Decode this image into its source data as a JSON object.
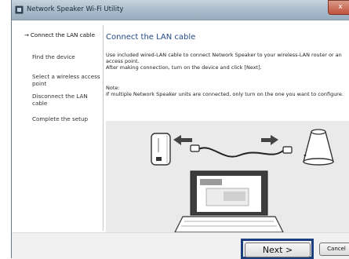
{
  "window": {
    "title": "Network Speaker Wi-Fi Utility",
    "close_glyph": "x"
  },
  "sidebar": {
    "steps": [
      {
        "label": "Connect the LAN cable",
        "active": true
      },
      {
        "label": "Find the device",
        "active": false
      },
      {
        "label": "Select a wireless access point",
        "active": false
      },
      {
        "label": "Disconnect the LAN cable",
        "active": false
      },
      {
        "label": "Complete the setup",
        "active": false
      }
    ],
    "active_arrow": "→"
  },
  "main": {
    "title": "Connect the LAN cable",
    "instructions": "Use included wired-LAN cable to connect Network Speaker to your wireless-LAN router or an access point.",
    "after_connect": "After making connection, turn on the device and click [Next].",
    "note_label": "Note:",
    "note_text": "If multiple Network Speaker units are connected, only turn on the one you want to configure."
  },
  "footer": {
    "next_label": "Next >",
    "cancel_label": "Cancel"
  },
  "colors": {
    "title_blue": "#234a86",
    "highlight_border": "#1c3e7c",
    "illustration_bg": "#eaeaea"
  }
}
